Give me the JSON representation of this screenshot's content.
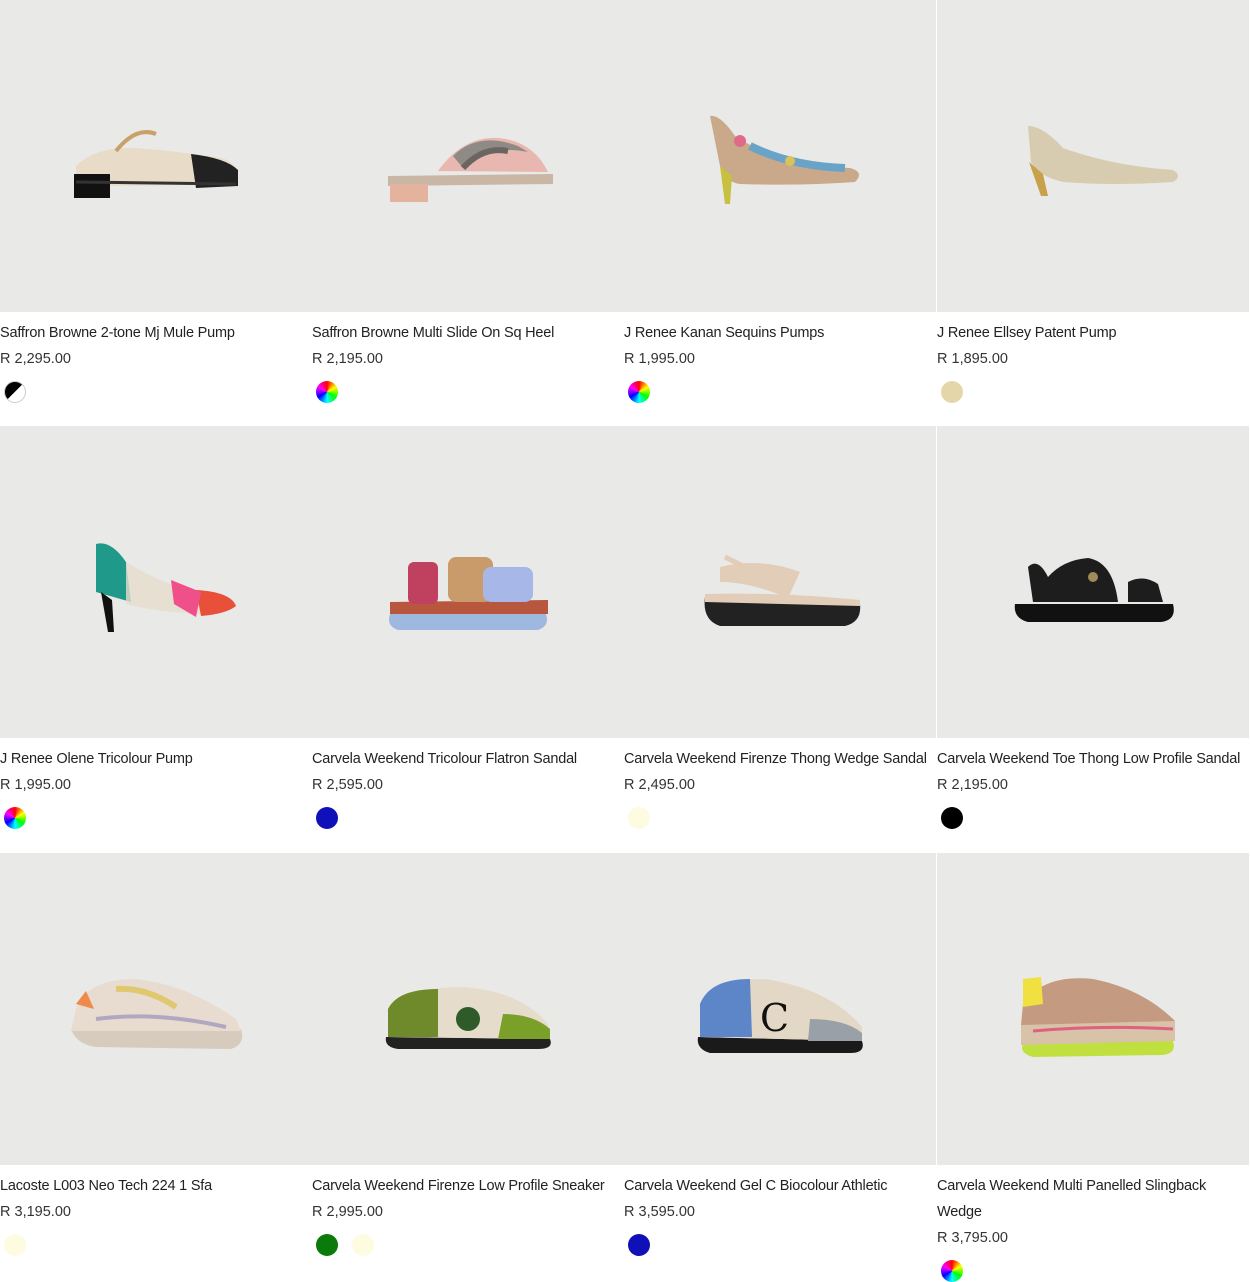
{
  "products": [
    {
      "name": "Saffron Browne 2-tone Mj Mule Pump",
      "price": "R 2,295.00",
      "shoe": "mule",
      "swatches": [
        {
          "type": "bw",
          "name": "black-white"
        }
      ]
    },
    {
      "name": "Saffron Browne Multi Slide On Sq Heel",
      "price": "R 2,195.00",
      "shoe": "slide",
      "swatches": [
        {
          "type": "rainbow",
          "name": "multi"
        }
      ]
    },
    {
      "name": "J Renee Kanan Sequins Pumps",
      "price": "R 1,995.00",
      "shoe": "pump-sequin",
      "swatches": [
        {
          "type": "rainbow",
          "name": "multi"
        }
      ]
    },
    {
      "name": "J Renee Ellsey Patent Pump",
      "price": "R 1,895.00",
      "shoe": "pump-beige",
      "swatches": [
        {
          "type": "solid",
          "color": "#e4d6a8",
          "name": "beige"
        }
      ]
    },
    {
      "name": "J Renee Olene Tricolour Pump",
      "price": "R 1,995.00",
      "shoe": "pump-tricolour",
      "swatches": [
        {
          "type": "rainbow",
          "name": "multi"
        }
      ]
    },
    {
      "name": "Carvela Weekend Tricolour Flatron Sandal",
      "price": "R 2,595.00",
      "shoe": "sandal-flatron",
      "swatches": [
        {
          "type": "solid",
          "color": "#1010b8",
          "name": "blue"
        }
      ]
    },
    {
      "name": "Carvela Weekend Firenze Thong Wedge Sandal",
      "price": "R 2,495.00",
      "shoe": "thong-wedge",
      "swatches": [
        {
          "type": "solid",
          "color": "#fdfbe0",
          "name": "cream"
        }
      ]
    },
    {
      "name": "Carvela Weekend Toe Thong Low Profile Sandal",
      "price": "R 2,195.00",
      "shoe": "thong-black",
      "swatches": [
        {
          "type": "solid",
          "color": "#000000",
          "name": "black"
        }
      ]
    },
    {
      "name": "Lacoste L003 Neo Tech 224 1 Sfa",
      "price": "R 3,195.00",
      "shoe": "sneaker-chunky",
      "swatches": [
        {
          "type": "solid",
          "color": "#fdfbe0",
          "name": "cream"
        }
      ]
    },
    {
      "name": "Carvela Weekend Firenze Low Profile Sneaker",
      "price": "R 2,995.00",
      "shoe": "sneaker-green",
      "swatches": [
        {
          "type": "solid",
          "color": "#0a7a0a",
          "name": "green"
        },
        {
          "type": "solid",
          "color": "#fdfbe0",
          "name": "cream"
        }
      ]
    },
    {
      "name": "Carvela Weekend Gel C Biocolour Athletic",
      "price": "R 3,595.00",
      "shoe": "sneaker-blue",
      "swatches": [
        {
          "type": "solid",
          "color": "#1010b8",
          "name": "blue"
        }
      ]
    },
    {
      "name": "Carvela Weekend Multi Panelled Slingback Wedge",
      "price": "R 3,795.00",
      "shoe": "sneaker-multi",
      "swatches": [
        {
          "type": "rainbow",
          "name": "multi"
        }
      ]
    }
  ]
}
